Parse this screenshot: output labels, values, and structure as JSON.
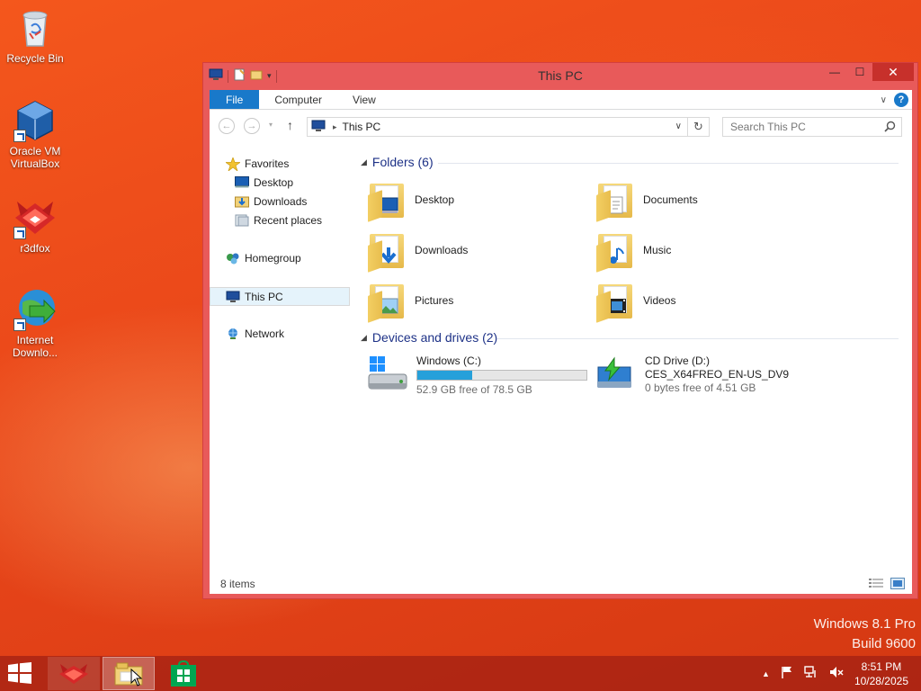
{
  "desktop": {
    "icons": [
      {
        "label": "Recycle Bin"
      },
      {
        "label": "Oracle VM VirtualBox"
      },
      {
        "label": "r3dfox"
      },
      {
        "label": "Internet Downlo..."
      }
    ],
    "watermark": {
      "line1": "Windows 8.1 Pro",
      "line2": "Build 9600"
    }
  },
  "window": {
    "title": "This PC",
    "controls": {
      "minimize": "—",
      "maximize": "☐",
      "close": "✕"
    },
    "ribbon": {
      "tabs": [
        "File",
        "Computer",
        "View"
      ],
      "help": "?"
    },
    "address": {
      "path": "This PC",
      "search_placeholder": "Search This PC"
    },
    "nav": {
      "favorites": "Favorites",
      "favorites_items": [
        "Desktop",
        "Downloads",
        "Recent places"
      ],
      "homegroup": "Homegroup",
      "this_pc": "This PC",
      "network": "Network"
    },
    "folders_header": "Folders (6)",
    "folders": [
      "Desktop",
      "Documents",
      "Downloads",
      "Music",
      "Pictures",
      "Videos"
    ],
    "drives_header": "Devices and drives (2)",
    "drives": [
      {
        "name": "Windows (C:)",
        "free_text": "52.9 GB free of 78.5 GB",
        "used_fraction": 0.326
      },
      {
        "name": "CD Drive (D:)",
        "label": "CES_X64FREO_EN-US_DV9",
        "free_text": "0 bytes free of 4.51 GB"
      }
    ],
    "status": "8 items"
  },
  "taskbar": {
    "clock_time": "8:51 PM",
    "clock_date": "10/28/2025"
  },
  "colors": {
    "accent": "#1979ca",
    "window_border": "#e85a5a",
    "close": "#c7302b"
  }
}
